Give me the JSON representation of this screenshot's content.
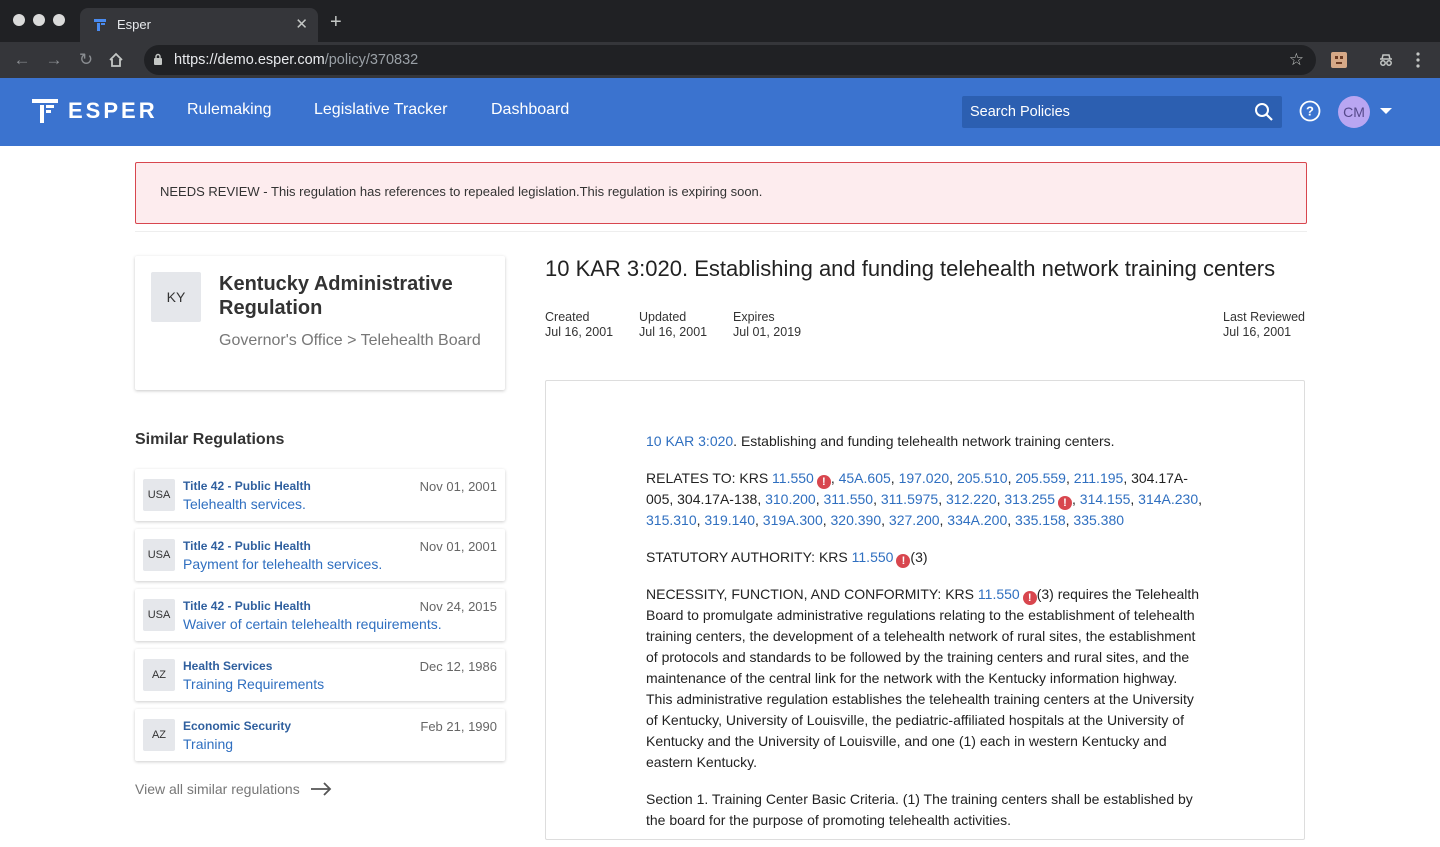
{
  "browser": {
    "tab_title": "Esper",
    "url_host": "https://demo.esper.com",
    "url_path": "/policy/370832"
  },
  "header": {
    "logo_text": "ESPER",
    "nav": [
      "Rulemaking",
      "Legislative Tracker",
      "Dashboard"
    ],
    "search_placeholder": "Search Policies",
    "avatar_initials": "CM"
  },
  "alert": {
    "text": "NEEDS REVIEW - This regulation has references to repealed legislation.This regulation is expiring soon."
  },
  "agency": {
    "state": "KY",
    "title": "Kentucky Administrative Regulation",
    "breadcrumb": "Governor's Office > Telehealth Board"
  },
  "similar": {
    "heading": "Similar Regulations",
    "items": [
      {
        "badge": "USA",
        "category": "Title 42 - Public Health",
        "title": "Telehealth services.",
        "date": "Nov 01, 2001"
      },
      {
        "badge": "USA",
        "category": "Title 42 - Public Health",
        "title": "Payment for telehealth services.",
        "date": "Nov 01, 2001"
      },
      {
        "badge": "USA",
        "category": "Title 42 - Public Health",
        "title": "Waiver of certain telehealth requirements.",
        "date": "Nov 24, 2015"
      },
      {
        "badge": "AZ",
        "category": "Health Services",
        "title": "Training Requirements",
        "date": "Dec 12, 1986"
      },
      {
        "badge": "AZ",
        "category": "Economic Security",
        "title": "Training",
        "date": "Feb 21, 1990"
      }
    ],
    "view_all": "View all similar regulations"
  },
  "document": {
    "title": "10 KAR 3:020.  Establishing and funding telehealth network training centers",
    "meta": {
      "created_label": "Created",
      "created": "Jul 16, 2001",
      "updated_label": "Updated",
      "updated": "Jul 16, 2001",
      "expires_label": "Expires",
      "expires": "Jul 01, 2019",
      "reviewed_label": "Last Reviewed",
      "reviewed": "Jul 16, 2001"
    },
    "heading_link": "10 KAR 3:020",
    "heading_rest": ". Establishing and funding telehealth network training centers.",
    "relates_label": "RELATES TO: KRS ",
    "relates": [
      {
        "text": "11.550",
        "link": true,
        "flag": true
      },
      {
        "text": "45A.605",
        "link": true
      },
      {
        "text": "197.020",
        "link": true
      },
      {
        "text": "205.510",
        "link": true
      },
      {
        "text": "205.559",
        "link": true
      },
      {
        "text": "211.195",
        "link": true
      },
      {
        "text": "304.17A-005",
        "link": false
      },
      {
        "text": "304.17A-138",
        "link": false
      },
      {
        "text": "310.200",
        "link": true
      },
      {
        "text": "311.550",
        "link": true
      },
      {
        "text": "311.5975",
        "link": true
      },
      {
        "text": "312.220",
        "link": true
      },
      {
        "text": "313.255",
        "link": true,
        "flag": true
      },
      {
        "text": "314.155",
        "link": true
      },
      {
        "text": "314A.230",
        "link": true
      },
      {
        "text": "315.310",
        "link": true
      },
      {
        "text": "319.140",
        "link": true
      },
      {
        "text": "319A.300",
        "link": true
      },
      {
        "text": "320.390",
        "link": true
      },
      {
        "text": "327.200",
        "link": true
      },
      {
        "text": "334A.200",
        "link": true
      },
      {
        "text": "335.158",
        "link": true
      },
      {
        "text": "335.380",
        "link": true
      }
    ],
    "statutory_label": "STATUTORY AUTHORITY: KRS ",
    "statutory_link": "11.550",
    "statutory_suffix": "(3)",
    "necessity_label": "NECESSITY, FUNCTION, AND CONFORMITY: KRS ",
    "necessity_link": "11.550",
    "necessity_text": "(3) requires the Telehealth Board to promulgate administrative regulations relating to the establishment of telehealth training centers, the development of a telehealth network of rural sites, the establishment of protocols and standards to be followed by the training centers and rural sites, and the maintenance of the central link for the network with the Kentucky information highway. This administrative regulation establishes the telehealth training centers at the University of Kentucky, University of Louisville, the pediatric-affiliated hospitals at the University of Kentucky and the University of Louisville, and one (1) each in western Kentucky and eastern Kentucky.",
    "section1": "Section 1. Training Center Basic Criteria. (1) The training centers shall be established by the board for the purpose of promoting telehealth activities."
  },
  "colors": {
    "appbar": "#3b73cf",
    "link": "#2f6fc0",
    "alert_border": "#d8464e",
    "alert_bg": "#fdecee"
  }
}
